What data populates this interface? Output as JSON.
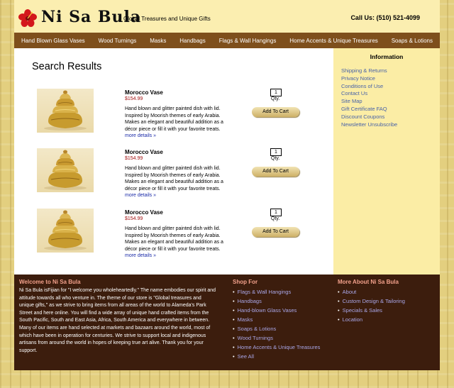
{
  "header": {
    "logo_text": "Ni Sa Bula",
    "tagline": "Global Treasures and Unique Gifts",
    "phone": "Call  Us: (510) 521-4099"
  },
  "nav": [
    "Hand Blown Glass Vases",
    "Wood Turnings",
    "Masks",
    "Handbags",
    "Flags & Wall Hangings",
    "Home Accents & Unique Treasures",
    "Soaps & Lotions"
  ],
  "main": {
    "title": "Search Results",
    "products": [
      {
        "name": "Morocco Vase",
        "price": "$154.99",
        "description": "Hand blown and glitter painted dish with lid. Inspired by Moorish themes of early Arabia.  Makes an elegant and beautiful addition as a décor piece or fill it with your favorite treats.",
        "more": "more details »",
        "qty": "1",
        "qty_label": "Qty.",
        "add_label": "Add To Cart"
      },
      {
        "name": "Morocco Vase",
        "price": "$154.99",
        "description": "Hand blown and glitter painted dish with lid. Inspired by Moorish themes of early Arabia.  Makes an elegant and beautiful addition as a décor piece or fill it with your favorite treats.",
        "more": "more details »",
        "qty": "1",
        "qty_label": "Qty.",
        "add_label": "Add To Cart"
      },
      {
        "name": "Morocco Vase",
        "price": "$154.99",
        "description": "Hand blown and glitter painted dish with lid. Inspired by Moorish themes of early Arabia.  Makes an elegant and beautiful addition as a décor piece or fill it with your favorite treats.",
        "more": "more details »",
        "qty": "1",
        "qty_label": "Qty.",
        "add_label": "Add To Cart"
      }
    ]
  },
  "sidebar": {
    "title": "Information",
    "links": [
      "Shipping & Returns",
      "Privacy Notice",
      "Conditions of Use",
      "Contact Us",
      "Site Map",
      "Gift Certificate FAQ",
      "Discount Coupons",
      "Newsletter Unsubscribe"
    ]
  },
  "footer": {
    "welcome_title": "Welcome to Ni Sa Bula",
    "welcome_text": "Ni Sa Bula isFijian for \"I welcome you wholeheartedly.\" The name embodies our spirit and attitude towards all who venture in. The theme of our store is \"Global treasures and unique gifts,\" as we strive to bring items from all areas of the world to Alameda's Park Street and here online. You will find a wide array of unique hand crafted items from the South Pacific, South and East Asia, Africa, South America and everywhere in between. Many of our items are hand selected at markets and bazaars around the world, most of which have been in operation for centuries. We strive to support local and indigenous artisans from around the world in hopes of keeping true art alive. Thank you for your support.",
    "shop_title": "Shop For",
    "shop_links": [
      "Flags & Wall Hangings",
      "Handbags",
      "Hand-blown Glass Vases",
      "Masks",
      "Soaps & Lotions",
      "Wood Turnings",
      "Home Accents & Unique Treasures",
      "See All"
    ],
    "more_title": "More About Ni Sa Bula",
    "more_links": [
      "About",
      "Custom Design & Tailoring",
      "Specials & Sales",
      "Location"
    ]
  },
  "colors": {
    "nav_bg": "#7e4f1c",
    "footer_bg": "#3c1d0d",
    "sidebar_bg": "#fbeda5",
    "price": "#a21010",
    "footer_heading": "#f2a08b",
    "footer_link": "#a9a7e8",
    "logo_flower": "#d3171b"
  },
  "icons": {
    "logo": "hibiscus-flower-icon",
    "product_image": "gold-lidded-vase"
  }
}
